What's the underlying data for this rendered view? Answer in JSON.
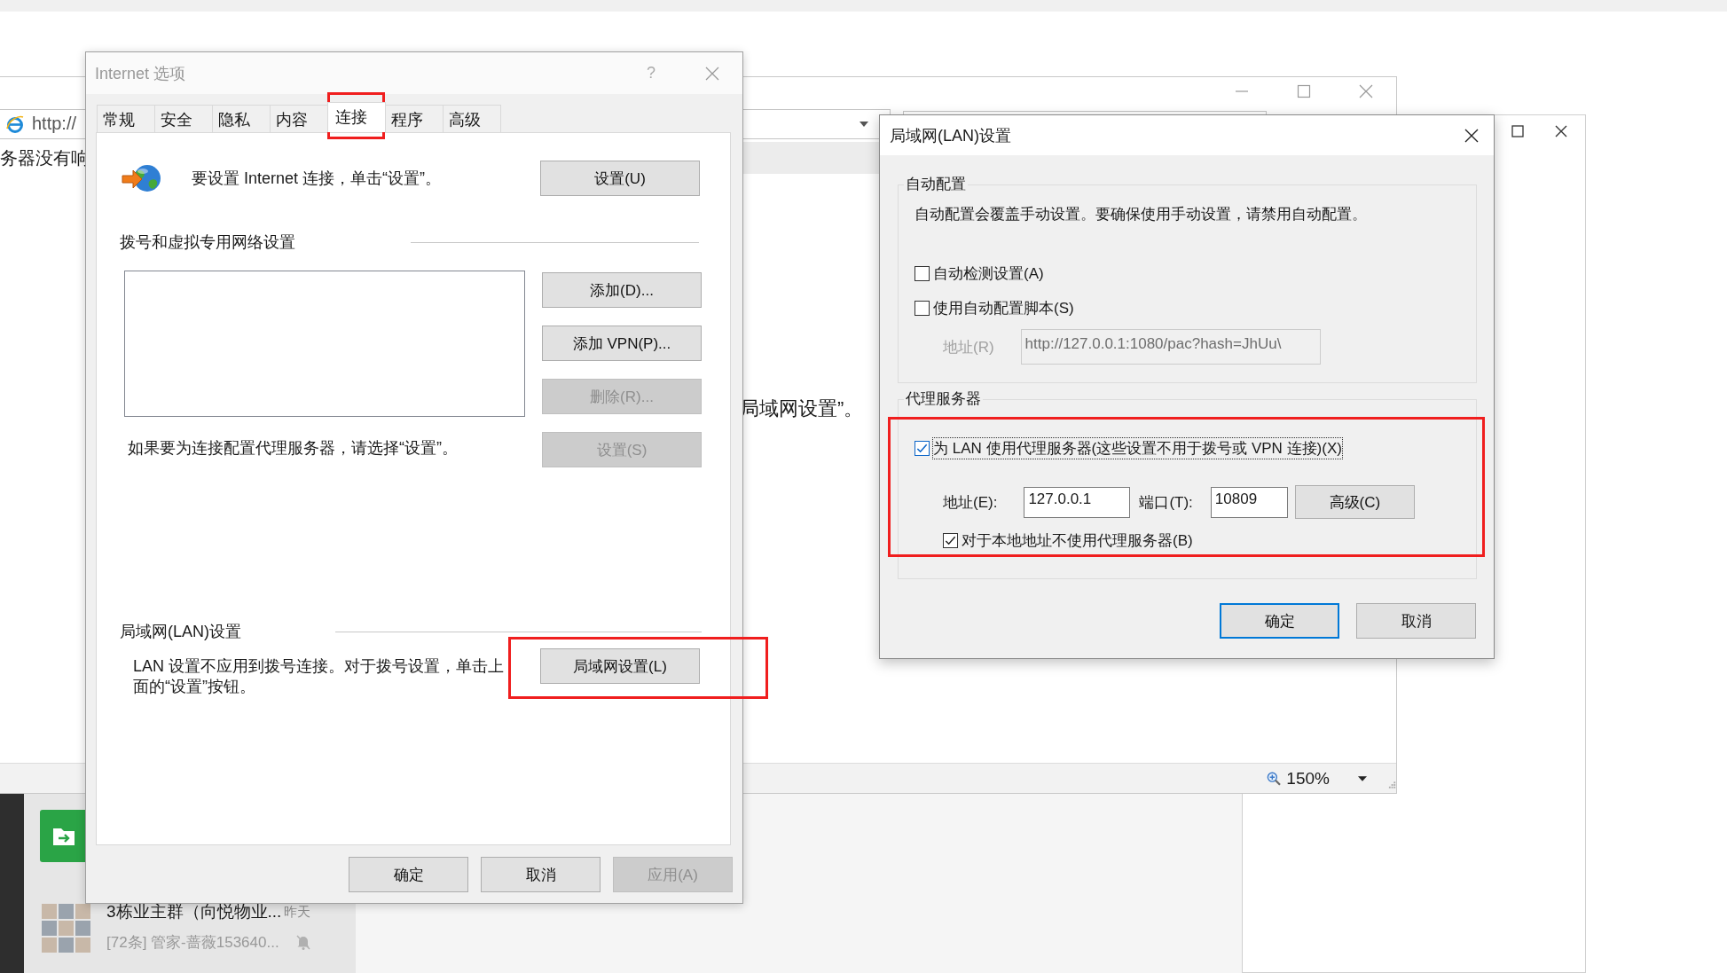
{
  "browser": {
    "address": "http://",
    "content_line_top": "务器没有响",
    "content_line_middle": "局域网设置”。",
    "zoom": "150%"
  },
  "options_dialog": {
    "title": "Internet 选项",
    "help": "?",
    "tabs": [
      {
        "label": "常规",
        "selected": false,
        "highlighted": false
      },
      {
        "label": "安全",
        "selected": false,
        "highlighted": false
      },
      {
        "label": "隐私",
        "selected": false,
        "highlighted": false
      },
      {
        "label": "内容",
        "selected": false,
        "highlighted": false
      },
      {
        "label": "连接",
        "selected": true,
        "highlighted": true
      },
      {
        "label": "程序",
        "selected": false,
        "highlighted": false
      },
      {
        "label": "高级",
        "selected": false,
        "highlighted": false
      }
    ],
    "setup_text": "要设置 Internet 连接，单击“设置”。",
    "setup_button": "设置(U)",
    "dialup_heading": "拨号和虚拟专用网络设置",
    "dialup_buttons": [
      {
        "label": "添加(D)...",
        "disabled": false
      },
      {
        "label": "添加 VPN(P)...",
        "disabled": false
      },
      {
        "label": "删除(R)...",
        "disabled": true
      },
      {
        "label": "设置(S)",
        "disabled": true
      }
    ],
    "proxy_hint": "如果要为连接配置代理服务器，请选择“设置”。",
    "lan_heading": "局域网(LAN)设置",
    "lan_text": "LAN 设置不应用到拨号连接。对于拨号设置，单击上面的“设置”按钮。",
    "lan_button": {
      "label": "局域网设置(L)",
      "highlighted": true
    },
    "footer_buttons": [
      {
        "label": "确定",
        "disabled": false
      },
      {
        "label": "取消",
        "disabled": false
      },
      {
        "label": "应用(A)",
        "disabled": true
      }
    ]
  },
  "lan_dialog": {
    "title": "局域网(LAN)设置",
    "auto_group": {
      "legend": "自动配置",
      "text": "自动配置会覆盖手动设置。要确保使用手动设置，请禁用自动配置。",
      "checks": [
        {
          "label": "自动检测设置(A)",
          "checked": false
        },
        {
          "label": "使用自动配置脚本(S)",
          "checked": false
        }
      ],
      "address_label": "地址(R)",
      "address_value": "http://127.0.0.1:1080/pac?hash=JhUu\\",
      "address_disabled": true
    },
    "proxy_group": {
      "legend": "代理服务器",
      "highlighted": true,
      "use_proxy": {
        "label": "为 LAN 使用代理服务器(这些设置不用于拨号或 VPN 连接)(X)",
        "checked": true,
        "focused": true
      },
      "address_label": "地址(E):",
      "address_value": "127.0.0.1",
      "port_label": "端口(T):",
      "port_value": "10809",
      "advanced_button": "高级(C)",
      "bypass_local": {
        "label": "对于本地地址不使用代理服务器(B)",
        "checked": true
      }
    },
    "buttons": [
      {
        "label": "确定",
        "default": true
      },
      {
        "label": "取消",
        "default": false
      }
    ]
  },
  "chat": {
    "title": "3栋业主群（向悦物业...",
    "time": "昨天",
    "preview": "[72条] 管家-蔷薇153640...",
    "muted": true
  }
}
